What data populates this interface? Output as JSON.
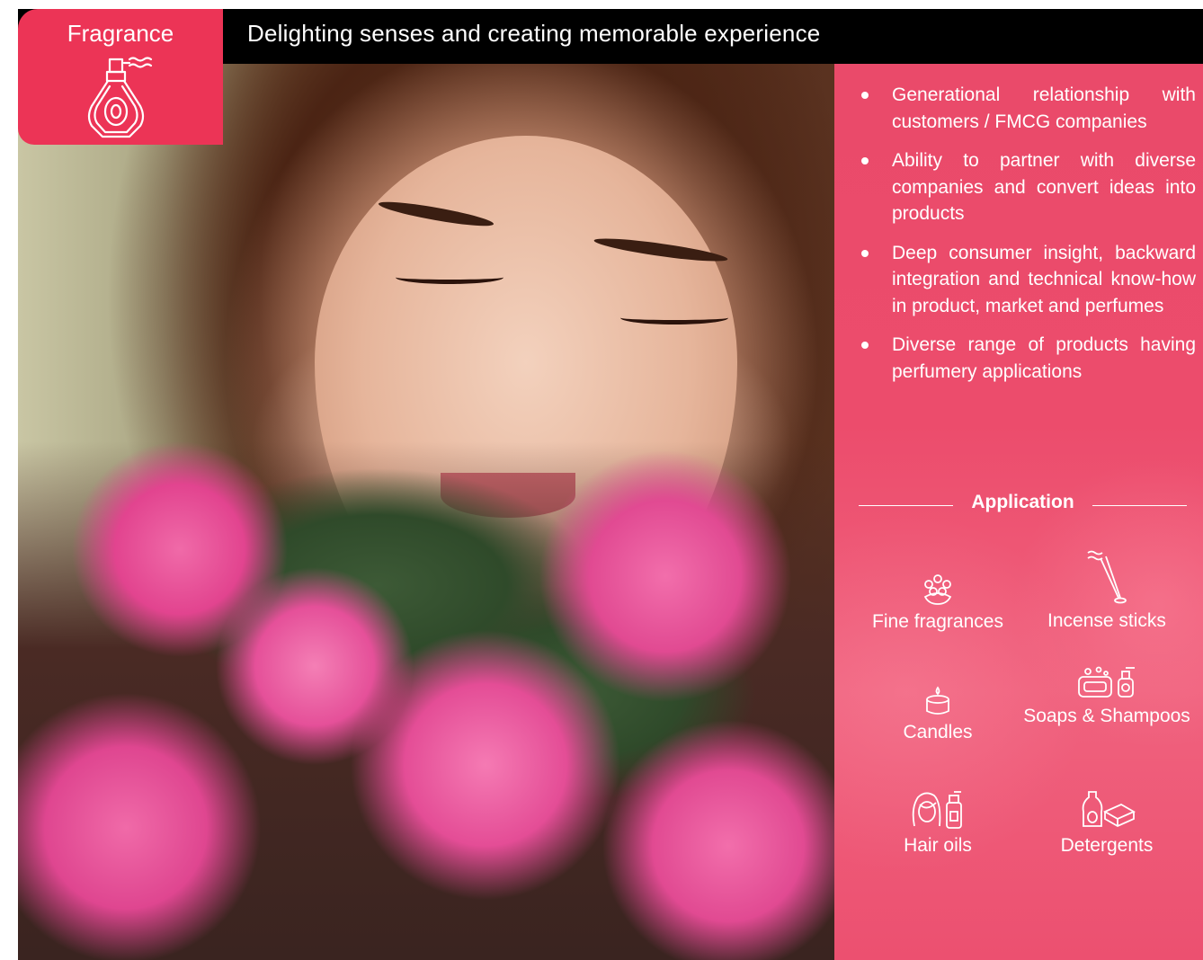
{
  "header": {
    "category": "Fragrance",
    "tagline": "Delighting senses and creating memorable experience"
  },
  "colors": {
    "accent": "#ec3456",
    "panel": "#ec4c6c",
    "header_bg": "#000000"
  },
  "category_icon": "perfume-bottle-icon",
  "highlights": [
    "Generational relationship with customers / FMCG companies",
    "Ability to partner with diverse companies and convert ideas into products",
    "Deep consumer insight, backward integration and technical know-how in product, market and perfumes",
    "Diverse range of products having perfumery applications"
  ],
  "applications": {
    "heading": "Application",
    "items": [
      {
        "label": "Fine fragrances",
        "icon": "flower-bouquet-icon"
      },
      {
        "label": "Incense sticks",
        "icon": "incense-sticks-icon"
      },
      {
        "label": "Candles",
        "icon": "candle-icon"
      },
      {
        "label": "Soaps & Shampoos",
        "icon": "soap-shampoo-icon"
      },
      {
        "label": "Hair oils",
        "icon": "hair-oil-icon"
      },
      {
        "label": "Detergents",
        "icon": "detergent-icon"
      }
    ]
  }
}
